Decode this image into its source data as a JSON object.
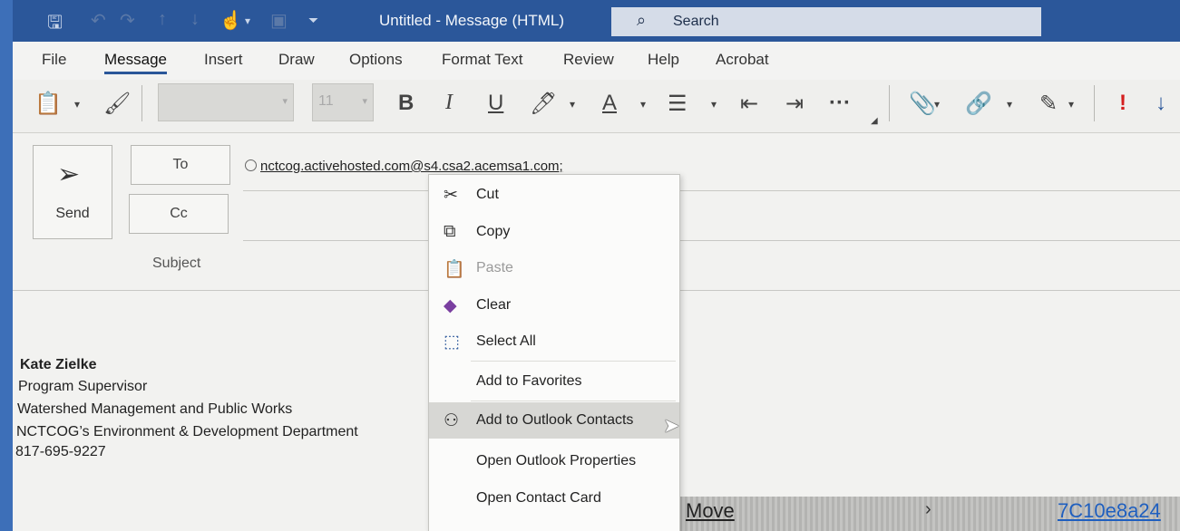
{
  "titlebar": {
    "quick_access": [
      "save-icon",
      "undo-icon",
      "redo-icon",
      "up-icon",
      "down-icon",
      "touch-icon",
      "dropdown-icon",
      "clipboard-icon",
      "customize-icon"
    ],
    "title": "Untitled  -  Message (HTML)",
    "search_label": "Search"
  },
  "tabs": [
    "File",
    "Message",
    "Insert",
    "Draw",
    "Options",
    "Format Text",
    "Review",
    "Help",
    "Acrobat"
  ],
  "active_tab": "Message",
  "ribbon": {
    "font_size": "11",
    "bold": "B",
    "italic": "I",
    "underline": "U",
    "font_color": "A",
    "more": "···",
    "importance_high": "!",
    "importance_low": "↓"
  },
  "compose": {
    "send_label": "Send",
    "to_label": "To",
    "cc_label": "Cc",
    "subject_label": "Subject",
    "to_recipient": "nctcog.activehosted.com@s4.csa2.acemsa1.com;"
  },
  "signature": {
    "name": "Kate Zielke",
    "title": "Program Supervisor",
    "division": "Watershed Management and Public Works",
    "department": "NCTCOG’s Environment & Development Department",
    "phone": "817-695-9227"
  },
  "context_menu": {
    "cut": "Cut",
    "copy": "Copy",
    "paste": "Paste",
    "clear": "Clear",
    "select_all": "Select All",
    "add_to_favorites": "Add to Favorites",
    "add_to_outlook_contacts": "Add to Outlook Contacts",
    "open_outlook_properties": "Open Outlook Properties",
    "open_contact_card": "Open Contact Card"
  },
  "bottom_strip": {
    "move_label": "Move",
    "item_id": "7C10e8a24"
  },
  "colors": {
    "titlebar": "#2b579a",
    "accent": "#2b579a",
    "link": "#1f5fbf",
    "importance": "#d41e1e"
  }
}
